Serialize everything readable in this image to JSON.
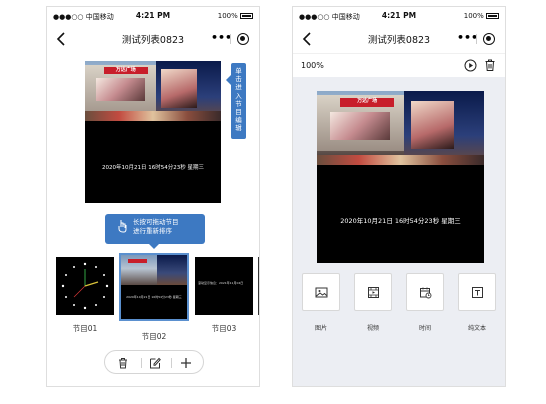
{
  "status": {
    "signal": "●●●○○ 中国移动",
    "time": "4:21 PM",
    "battery": "100%"
  },
  "nav": {
    "title": "测试列表0823"
  },
  "preview": {
    "datetime": "2020年10月21日 16时54分23秒 星期三",
    "sign_text": "万达广场"
  },
  "left": {
    "tip_right": [
      "单",
      "击",
      "进",
      "入",
      "节",
      "目",
      "编",
      "辑"
    ],
    "tip_bottom": {
      "line1": "长按可拖动节目",
      "line2": "进行重新排序"
    },
    "programs": [
      {
        "label": "节目01"
      },
      {
        "label": "节目02"
      },
      {
        "label": "节目03"
      }
    ],
    "thumb3_text": "滚动显示信息：2021年11月04日"
  },
  "right": {
    "zoom": "100%",
    "types": [
      {
        "label": "图片",
        "icon": "image-icon"
      },
      {
        "label": "视频",
        "icon": "video-icon"
      },
      {
        "label": "时间",
        "icon": "clock-icon"
      },
      {
        "label": "纯文本",
        "icon": "text-icon"
      }
    ]
  },
  "colors": {
    "accent": "#3d79c2",
    "selection": "#5b90cf",
    "right_bg": "#eceef3"
  }
}
